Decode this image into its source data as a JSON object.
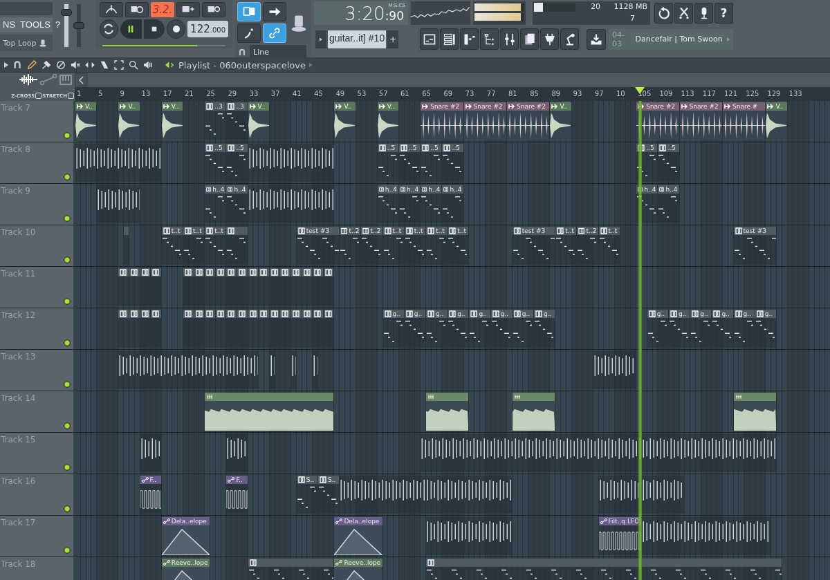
{
  "menu": {
    "items": [
      "NS",
      "TOOLS",
      "?"
    ]
  },
  "top_loop": {
    "label": "Top Loop"
  },
  "master_volume": {
    "level": 0.8
  },
  "master_pitch": {
    "level": 0.5
  },
  "transport": {
    "display": "3.2.",
    "playing": true,
    "recording": false,
    "tempo": "122",
    "tempo_decimals": ".000",
    "pitch": {
      "level": 0.77
    }
  },
  "toolbar_toggles": [
    {
      "kind": "typing-keyboard",
      "on": true
    },
    {
      "kind": "arrow",
      "on": false
    },
    {
      "kind": "step",
      "on": false
    },
    {
      "kind": "link",
      "on": true
    }
  ],
  "snap": {
    "value": "Line"
  },
  "time": {
    "value": "3:20",
    "sub": ":90",
    "format": "M:S:CS"
  },
  "pattern": {
    "name": "guitar..it] #10",
    "add": "+"
  },
  "meters": [
    {
      "level": 0.93
    },
    {
      "level": 0.93
    }
  ],
  "monitor": {
    "polyphony": "20",
    "memory": "1128 MB",
    "cpu": "7",
    "load": {
      "level": 0.22
    }
  },
  "help_button": "?",
  "news": {
    "date": "04-03",
    "title": "Dancefair | Tom Swoon"
  },
  "playlist": {
    "title": "Playlist - 060outerspacelove",
    "z_cross": {
      "label": "Z-CROSS",
      "checked": false
    },
    "stretch": {
      "label": "STRETCH",
      "checked": false
    },
    "ruler": [
      "1",
      "5",
      "9",
      "13",
      "17",
      "21",
      "25",
      "29",
      "33",
      "37",
      "41",
      "45",
      "49",
      "53",
      "57",
      "61",
      "65",
      "69",
      "73",
      "77",
      "81",
      "85",
      "89",
      "93",
      "97",
      "10",
      "105",
      "109",
      "113",
      "117",
      "121",
      "125",
      "129",
      "133"
    ],
    "song_position": {
      "level": 0.748
    },
    "tracks": [
      {
        "name": "Track 7",
        "on": true,
        "clips": [
          {
            "kind": "audio",
            "label": "V..",
            "color": "#5e7a5c"
          },
          {
            "kind": "audio",
            "label": "V..",
            "color": "#5e7a5c"
          },
          {
            "kind": "audio",
            "label": "V..",
            "color": "#5e7a5c"
          },
          {
            "kind": "pattern",
            "label": "..3",
            "color": "#4f5a62"
          },
          {
            "kind": "pattern",
            "label": "..3",
            "color": "#4f5a62"
          },
          {
            "kind": "audio",
            "label": "V..",
            "color": "#5e7a5c"
          },
          {
            "kind": "audio",
            "label": "V..",
            "color": "#5e7a5c"
          },
          {
            "kind": "audio",
            "label": "V..",
            "color": "#5e7a5c"
          },
          {
            "kind": "hits",
            "label": "Snare #2",
            "color": "#7a5f74"
          },
          {
            "kind": "hits",
            "label": "Snare #2",
            "color": "#7a5f74"
          },
          {
            "kind": "hits",
            "label": "Snare #2",
            "color": "#7a5f74"
          },
          {
            "kind": "audio",
            "label": "V..",
            "color": "#5e7a5c"
          },
          {
            "kind": "hits",
            "label": "Snare #2",
            "color": "#7a5f74"
          },
          {
            "kind": "hits",
            "label": "Snare #2",
            "color": "#7a5f74"
          },
          {
            "kind": "hits",
            "label": "Snare #",
            "color": "#7a5f74"
          },
          {
            "kind": "audio",
            "label": "V..",
            "color": "#5e7a5c"
          }
        ]
      },
      {
        "name": "Track 8",
        "on": true,
        "clips": [
          {
            "kind": "bars"
          },
          {
            "kind": "pattern",
            "label": "..5",
            "color": "#4f5a62"
          },
          {
            "kind": "pattern",
            "label": "..5",
            "color": "#4f5a62"
          },
          {
            "kind": "bars"
          },
          {
            "kind": "pattern",
            "label": "..5",
            "color": "#4f5a62"
          },
          {
            "kind": "pattern",
            "label": "..5",
            "color": "#4f5a62"
          },
          {
            "kind": "pattern",
            "label": "..5",
            "color": "#4f5a62"
          },
          {
            "kind": "pattern",
            "label": "..5",
            "color": "#4f5a62"
          },
          {
            "kind": "pattern",
            "label": "..5",
            "color": "#4f5a62"
          },
          {
            "kind": "pattern",
            "label": "..5",
            "color": "#4f5a62"
          }
        ]
      },
      {
        "name": "Track 9",
        "on": true,
        "clips": [
          {
            "kind": "bars"
          },
          {
            "kind": "pattern",
            "label": "h..4",
            "color": "#4f5a62"
          },
          {
            "kind": "pattern",
            "label": "h..4",
            "color": "#4f5a62"
          },
          {
            "kind": "bars"
          },
          {
            "kind": "pattern",
            "label": "h..4",
            "color": "#4f5a62"
          },
          {
            "kind": "pattern",
            "label": "h..4",
            "color": "#4f5a62"
          },
          {
            "kind": "pattern",
            "label": "h..4",
            "color": "#4f5a62"
          },
          {
            "kind": "pattern",
            "label": "h..4",
            "color": "#4f5a62"
          },
          {
            "kind": "pattern",
            "label": "h..4",
            "color": "#4f5a62"
          },
          {
            "kind": "pattern",
            "label": "h..4",
            "color": "#4f5a62"
          }
        ]
      },
      {
        "name": "Track 10",
        "on": true,
        "clips": [
          {
            "kind": "pattern",
            "color": "#4f5a62"
          },
          {
            "kind": "pattern",
            "label": "t..t",
            "color": "#4f5a62"
          },
          {
            "kind": "pattern",
            "label": "t..t",
            "color": "#4f5a62"
          },
          {
            "kind": "pattern",
            "label": "t..t",
            "color": "#4f5a62"
          },
          {
            "kind": "pattern",
            "color": "#4f5a62"
          },
          {
            "kind": "pattern",
            "label": "test #3",
            "color": "#4f5a62"
          },
          {
            "kind": "pattern",
            "label": "t..2",
            "color": "#4f5a62"
          },
          {
            "kind": "pattern",
            "label": "t..2",
            "color": "#4f5a62"
          },
          {
            "kind": "pattern",
            "label": "t..t",
            "color": "#4f5a62"
          },
          {
            "kind": "pattern",
            "label": "t..t",
            "color": "#4f5a62"
          },
          {
            "kind": "pattern",
            "label": "t..t",
            "color": "#4f5a62"
          },
          {
            "kind": "pattern",
            "label": "t..t",
            "color": "#4f5a62"
          },
          {
            "kind": "pattern",
            "label": "test #3",
            "color": "#4f5a62"
          },
          {
            "kind": "pattern",
            "label": "t..t",
            "color": "#4f5a62"
          },
          {
            "kind": "pattern",
            "label": "t..2",
            "color": "#4f5a62"
          },
          {
            "kind": "pattern",
            "label": "t..t",
            "color": "#4f5a62"
          },
          {
            "kind": "pattern",
            "label": "test #3",
            "color": "#4f5a62"
          }
        ]
      },
      {
        "name": "Track 11",
        "on": true,
        "clips": [
          {
            "kind": "pattern",
            "color": "#4f5a62"
          },
          {
            "kind": "pattern",
            "color": "#4f5a62"
          },
          {
            "kind": "pattern",
            "color": "#4f5a62"
          },
          {
            "kind": "pattern",
            "color": "#4f5a62"
          },
          {
            "kind": "pattern",
            "color": "#4f5a62"
          },
          {
            "kind": "pattern",
            "color": "#4f5a62"
          },
          {
            "kind": "pattern",
            "color": "#4f5a62"
          },
          {
            "kind": "pattern",
            "color": "#4f5a62"
          },
          {
            "kind": "pattern",
            "color": "#4f5a62"
          },
          {
            "kind": "pattern",
            "color": "#4f5a62"
          },
          {
            "kind": "pattern",
            "color": "#4f5a62"
          },
          {
            "kind": "pattern",
            "color": "#4f5a62"
          },
          {
            "kind": "pattern",
            "color": "#4f5a62"
          },
          {
            "kind": "pattern",
            "color": "#4f5a62"
          },
          {
            "kind": "pattern",
            "color": "#4f5a62"
          },
          {
            "kind": "pattern",
            "color": "#4f5a62"
          },
          {
            "kind": "pattern",
            "color": "#4f5a62"
          },
          {
            "kind": "pattern",
            "color": "#4f5a62"
          }
        ]
      },
      {
        "name": "Track 12",
        "on": true,
        "clips": [
          {
            "kind": "pattern",
            "color": "#4f5a62"
          },
          {
            "kind": "pattern",
            "color": "#4f5a62"
          },
          {
            "kind": "pattern",
            "color": "#4f5a62"
          },
          {
            "kind": "pattern",
            "color": "#4f5a62"
          },
          {
            "kind": "pattern",
            "color": "#4f5a62"
          },
          {
            "kind": "pattern",
            "color": "#4f5a62"
          },
          {
            "kind": "pattern",
            "color": "#4f5a62"
          },
          {
            "kind": "pattern",
            "color": "#4f5a62"
          },
          {
            "kind": "pattern",
            "color": "#4f5a62"
          },
          {
            "kind": "pattern",
            "color": "#4f5a62"
          },
          {
            "kind": "pattern",
            "color": "#4f5a62"
          },
          {
            "kind": "pattern",
            "color": "#4f5a62"
          },
          {
            "kind": "pattern",
            "color": "#4f5a62"
          },
          {
            "kind": "pattern",
            "color": "#4f5a62"
          },
          {
            "kind": "pattern",
            "color": "#4f5a62"
          },
          {
            "kind": "pattern",
            "color": "#4f5a62"
          },
          {
            "kind": "pattern",
            "color": "#4f5a62"
          },
          {
            "kind": "pattern",
            "color": "#4f5a62"
          },
          {
            "kind": "pattern",
            "label": "g..",
            "color": "#4f5a62"
          },
          {
            "kind": "pattern",
            "label": "g..",
            "color": "#4f5a62"
          },
          {
            "kind": "pattern",
            "label": "g..",
            "color": "#4f5a62"
          },
          {
            "kind": "pattern",
            "label": "g..",
            "color": "#4f5a62"
          },
          {
            "kind": "pattern",
            "label": "g..",
            "color": "#4f5a62"
          },
          {
            "kind": "pattern",
            "label": "g..",
            "color": "#4f5a62"
          },
          {
            "kind": "pattern",
            "label": "g..",
            "color": "#4f5a62"
          },
          {
            "kind": "pattern",
            "label": "g..",
            "color": "#4f5a62"
          },
          {
            "kind": "pattern",
            "label": "g..",
            "color": "#4f5a62"
          },
          {
            "kind": "pattern",
            "label": "g..",
            "color": "#4f5a62"
          },
          {
            "kind": "pattern",
            "label": "g..",
            "color": "#4f5a62"
          },
          {
            "kind": "pattern",
            "label": "g..",
            "color": "#4f5a62"
          },
          {
            "kind": "pattern",
            "label": "g..",
            "color": "#4f5a62"
          },
          {
            "kind": "pattern",
            "label": "g..",
            "color": "#4f5a62"
          }
        ]
      },
      {
        "name": "Track 13",
        "on": true,
        "clips": [
          {
            "kind": "bars"
          },
          {
            "kind": "bars"
          },
          {
            "kind": "bars"
          },
          {
            "kind": "bars"
          },
          {
            "kind": "bars"
          }
        ]
      },
      {
        "name": "Track 14",
        "on": true,
        "clips": [
          {
            "kind": "sustain",
            "color": "#6d8a68"
          },
          {
            "kind": "sustain",
            "color": "#6d8a68"
          },
          {
            "kind": "sustain",
            "color": "#6d8a68"
          },
          {
            "kind": "sustain",
            "color": "#6d8a68"
          }
        ]
      },
      {
        "name": "Track 15",
        "on": true,
        "clips": [
          {
            "kind": "bars"
          },
          {
            "kind": "bars"
          },
          {
            "kind": "bars"
          }
        ]
      },
      {
        "name": "Track 16",
        "on": true,
        "clips": [
          {
            "kind": "lfo",
            "label": "F..",
            "color": "#675c8a"
          },
          {
            "kind": "lfo",
            "label": "F..",
            "color": "#675c8a"
          },
          {
            "kind": "pattern",
            "label": "S..",
            "color": "#4f5a62"
          },
          {
            "kind": "pattern",
            "label": "S..",
            "color": "#4f5a62"
          },
          {
            "kind": "bars"
          },
          {
            "kind": "bars"
          },
          {
            "kind": "bars"
          },
          {
            "kind": "bars"
          }
        ]
      },
      {
        "name": "Track 17",
        "on": true,
        "clips": [
          {
            "kind": "envelope",
            "label": "Dela..elope",
            "color": "#675c8a"
          },
          {
            "kind": "envelope",
            "label": "Dela..elope",
            "color": "#675c8a"
          },
          {
            "kind": "bars"
          },
          {
            "kind": "lfo",
            "label": "Filt..q LFO",
            "color": "#675c8a"
          },
          {
            "kind": "bars"
          }
        ]
      },
      {
        "name": "Track 18",
        "clips": [
          {
            "kind": "envelope",
            "label": "Reeve..lope",
            "color": "#5e7a5c"
          },
          {
            "kind": "pattern",
            "color": "#4f5a62"
          },
          {
            "kind": "envelope",
            "label": "Reeve..lope",
            "color": "#5e7a5c"
          },
          {
            "kind": "pattern",
            "color": "#4f5a62"
          }
        ]
      }
    ]
  }
}
